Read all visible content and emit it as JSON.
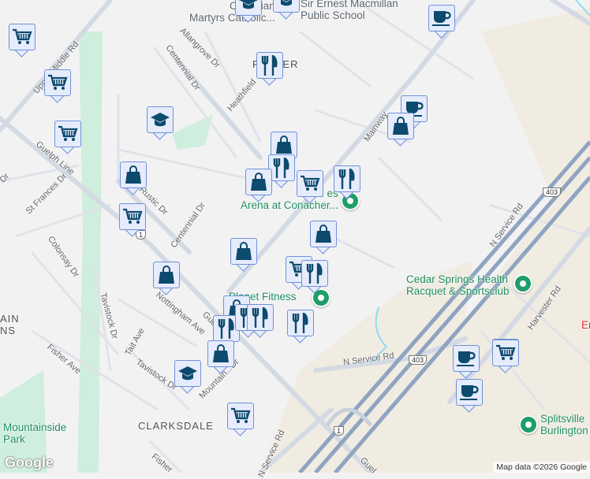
{
  "map": {
    "area_labels": {
      "palmer": "PALMER",
      "clarksdale": "CLARKSDALE",
      "mountain_1": "AIN",
      "mountain_2": "NS"
    },
    "streets": {
      "upper_middle": "Upper Middle Rd",
      "guelph_line": "Guelph Line",
      "guelph_line_2": "Guelph Line",
      "guelph_line_3": "Guel",
      "st_frances": "St Frances Dr",
      "colonsay": "Colonsay Dr",
      "centennial_1": "Centennial Dr",
      "centennial_2": "Centennial Dr",
      "allangrove": "Allangrove Dr",
      "heathfield": "Heathfield",
      "rustic": "Pa... Rustic Dr",
      "mainway": "Mainway",
      "nottingham": "Nottingham Ave",
      "tavistock_1": "Tavistock Dr",
      "tavistock_2": "Tavistock Dr",
      "tait": "Tait Ave",
      "fisher": "Fisher Ave",
      "fisher_2": "Fisher",
      "mountain": "Mountain...Dr",
      "n_service_1": "N Service Rd",
      "n_service_2": "N Service Rd",
      "n_service_3": "N Service Rd",
      "harvester": "Harvester Rd",
      "dr": "Dr"
    },
    "shields": {
      "hwy403_a": "403",
      "hwy403_b": "403",
      "hwy1_a": "1",
      "hwy1_b": "1"
    },
    "pois": {
      "canadian_martyrs": "Canadian\nMartyrs Catholic...",
      "sir_ernest": "Sir Ernest Macmillan\nPublic School",
      "arena": "Lub... es\nArena at Conacher...",
      "planet_fitness": "Planet Fitness",
      "cedar_springs": "Cedar Springs Health\nRacquet & Sportsclub",
      "splitsville": "Splitsville\nBurlington",
      "mountainside_park": "Mountainside\nPark",
      "em": "Em"
    },
    "markers": [
      "cart",
      "cart",
      "cart",
      "school",
      "bag",
      "cart",
      "school",
      "school",
      "coffee",
      "restaurant",
      "coffee",
      "bag",
      "bag",
      "restaurant",
      "bag",
      "cart",
      "restaurant",
      "bag",
      "bag",
      "bag",
      "cart",
      "restaurant",
      "bag",
      "restaurant",
      "restaurant",
      "restaurant",
      "restaurant",
      "bag",
      "school",
      "cart",
      "cart",
      "coffee",
      "cart",
      "coffee"
    ],
    "attribution": "Map data ©2026 Google",
    "logo": "Google",
    "colors": {
      "marker_fill": "#e6ecfb",
      "marker_border": "#6f91d8",
      "icon": "#0c4a6e",
      "poi_green": "#1e8e5f",
      "highway": "#8fa4c1"
    }
  }
}
